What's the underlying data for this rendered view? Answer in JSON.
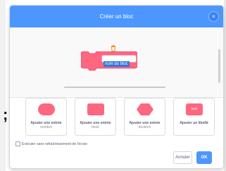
{
  "modal": {
    "title": "Créer un bloc",
    "close_icon": "close-icon",
    "close_symbol": "×"
  },
  "workspace": {
    "trash_icon": "trash-icon",
    "block_name": "nom du bloc",
    "block_color": "#ff6680",
    "selection_color": "#2f78e0"
  },
  "options": [
    {
      "title": "Ajouter une entrée",
      "subtitle": "nombre",
      "icon": "number-input-icon"
    },
    {
      "title": "Ajouter une entrée",
      "subtitle": "texte",
      "icon": "text-input-icon"
    },
    {
      "title": "Ajouter une entrée",
      "subtitle": "booléen",
      "icon": "boolean-input-icon"
    },
    {
      "title": "Ajouter un libellé",
      "subtitle": "",
      "icon": "label-icon",
      "icon_text": "text"
    }
  ],
  "checkbox": {
    "label": "Exécuter sans rafraîchissement de l'écran",
    "checked": false
  },
  "buttons": {
    "cancel": "Annuler",
    "ok": "OK"
  },
  "background": {
    "glyph": ";"
  },
  "colors": {
    "header": "#4c97ff",
    "ok_button": "#4c97ff",
    "block_pink": "#ff6680"
  }
}
